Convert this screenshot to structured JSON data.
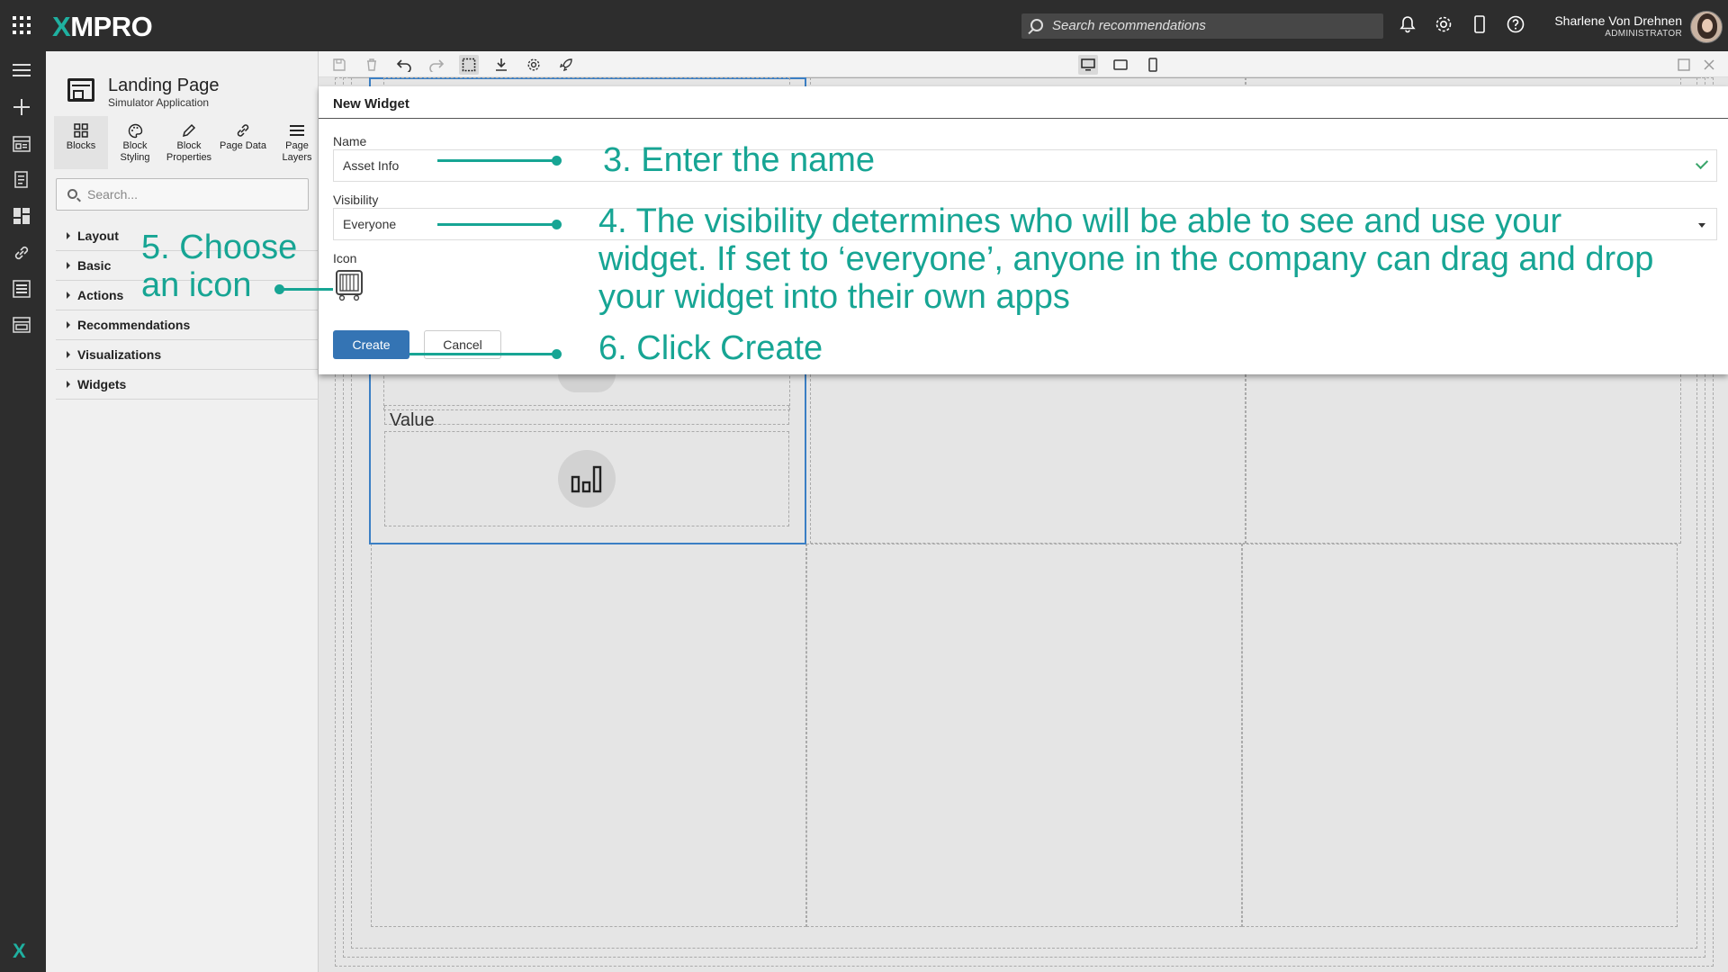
{
  "topbar": {
    "logo": "XMPRO",
    "search_placeholder": "Search recommendations",
    "user_name": "Sharlene Von Drehnen",
    "user_role": "ADMINISTRATOR",
    "icons": [
      "bell-icon",
      "gear-icon",
      "mobile-icon",
      "help-icon"
    ]
  },
  "rail": {
    "icons": [
      "menu-icon",
      "plus-icon",
      "apps-icon",
      "recommendations-icon",
      "dashboard-icon",
      "link-icon",
      "data-streams-icon",
      "widgets-icon"
    ]
  },
  "sidepanel": {
    "title": "Landing Page",
    "subtitle": "Simulator Application",
    "tabs": [
      {
        "label": "Blocks",
        "icon": "blocks-icon"
      },
      {
        "label": "Block Styling",
        "icon": "palette-icon"
      },
      {
        "label": "Block Properties",
        "icon": "pencil-icon"
      },
      {
        "label": "Page Data",
        "icon": "link-icon"
      },
      {
        "label": "Page Layers",
        "icon": "layers-icon"
      }
    ],
    "search_placeholder": "Search...",
    "categories": [
      "Layout",
      "Basic",
      "Actions",
      "Recommendations",
      "Visualizations",
      "Widgets"
    ]
  },
  "canvas": {
    "value_label": "Value"
  },
  "dialog": {
    "title": "New Widget",
    "name_label": "Name",
    "name_value": "Asset Info",
    "visibility_label": "Visibility",
    "visibility_value": "Everyone",
    "icon_label": "Icon",
    "create_label": "Create",
    "cancel_label": "Cancel"
  },
  "annotations": {
    "step3": "3. Enter the name",
    "step4_line1": "4. The visibility determines who will be able to see and use your",
    "step4_line2": "widget. If set to ‘everyone’, anyone in the company can drag and drop",
    "step4_line3": "your widget into their own apps",
    "step5_line1": "5. Choose",
    "step5_line2": "an icon",
    "step6": "6. Click Create",
    "color": "#17a594"
  }
}
